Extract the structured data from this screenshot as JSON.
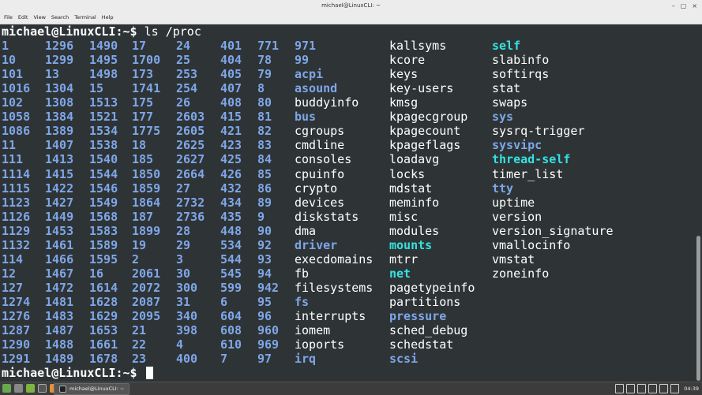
{
  "window": {
    "title": "michael@LinuxCLI: ~",
    "controls": [
      "–",
      "▢",
      "×"
    ]
  },
  "menu": [
    "File",
    "Edit",
    "View",
    "Search",
    "Terminal",
    "Help"
  ],
  "terminal": {
    "prompt": "michael@LinuxCLI",
    "prompt_suffix": ":~$ ",
    "command": "ls /proc",
    "columns": [
      [
        {
          "t": "1",
          "k": "num"
        },
        {
          "t": "10",
          "k": "num"
        },
        {
          "t": "101",
          "k": "num"
        },
        {
          "t": "1016",
          "k": "num"
        },
        {
          "t": "102",
          "k": "num"
        },
        {
          "t": "1058",
          "k": "num"
        },
        {
          "t": "1086",
          "k": "num"
        },
        {
          "t": "11",
          "k": "num"
        },
        {
          "t": "111",
          "k": "num"
        },
        {
          "t": "1114",
          "k": "num"
        },
        {
          "t": "1115",
          "k": "num"
        },
        {
          "t": "1123",
          "k": "num"
        },
        {
          "t": "1126",
          "k": "num"
        },
        {
          "t": "1129",
          "k": "num"
        },
        {
          "t": "1132",
          "k": "num"
        },
        {
          "t": "114",
          "k": "num"
        },
        {
          "t": "12",
          "k": "num"
        },
        {
          "t": "127",
          "k": "num"
        },
        {
          "t": "1274",
          "k": "num"
        },
        {
          "t": "1276",
          "k": "num"
        },
        {
          "t": "1287",
          "k": "num"
        },
        {
          "t": "1290",
          "k": "num"
        },
        {
          "t": "1291",
          "k": "num"
        }
      ],
      [
        {
          "t": "1296",
          "k": "num"
        },
        {
          "t": "1299",
          "k": "num"
        },
        {
          "t": "13",
          "k": "num"
        },
        {
          "t": "1304",
          "k": "num"
        },
        {
          "t": "1308",
          "k": "num"
        },
        {
          "t": "1384",
          "k": "num"
        },
        {
          "t": "1389",
          "k": "num"
        },
        {
          "t": "1407",
          "k": "num"
        },
        {
          "t": "1413",
          "k": "num"
        },
        {
          "t": "1415",
          "k": "num"
        },
        {
          "t": "1422",
          "k": "num"
        },
        {
          "t": "1427",
          "k": "num"
        },
        {
          "t": "1449",
          "k": "num"
        },
        {
          "t": "1453",
          "k": "num"
        },
        {
          "t": "1461",
          "k": "num"
        },
        {
          "t": "1466",
          "k": "num"
        },
        {
          "t": "1467",
          "k": "num"
        },
        {
          "t": "1472",
          "k": "num"
        },
        {
          "t": "1481",
          "k": "num"
        },
        {
          "t": "1483",
          "k": "num"
        },
        {
          "t": "1487",
          "k": "num"
        },
        {
          "t": "1488",
          "k": "num"
        },
        {
          "t": "1489",
          "k": "num"
        }
      ],
      [
        {
          "t": "1490",
          "k": "num"
        },
        {
          "t": "1495",
          "k": "num"
        },
        {
          "t": "1498",
          "k": "num"
        },
        {
          "t": "15",
          "k": "num"
        },
        {
          "t": "1513",
          "k": "num"
        },
        {
          "t": "1521",
          "k": "num"
        },
        {
          "t": "1534",
          "k": "num"
        },
        {
          "t": "1538",
          "k": "num"
        },
        {
          "t": "1540",
          "k": "num"
        },
        {
          "t": "1544",
          "k": "num"
        },
        {
          "t": "1546",
          "k": "num"
        },
        {
          "t": "1549",
          "k": "num"
        },
        {
          "t": "1568",
          "k": "num"
        },
        {
          "t": "1583",
          "k": "num"
        },
        {
          "t": "1589",
          "k": "num"
        },
        {
          "t": "1595",
          "k": "num"
        },
        {
          "t": "16",
          "k": "num"
        },
        {
          "t": "1614",
          "k": "num"
        },
        {
          "t": "1628",
          "k": "num"
        },
        {
          "t": "1629",
          "k": "num"
        },
        {
          "t": "1653",
          "k": "num"
        },
        {
          "t": "1661",
          "k": "num"
        },
        {
          "t": "1678",
          "k": "num"
        }
      ],
      [
        {
          "t": "17",
          "k": "num"
        },
        {
          "t": "1700",
          "k": "num"
        },
        {
          "t": "173",
          "k": "num"
        },
        {
          "t": "1741",
          "k": "num"
        },
        {
          "t": "175",
          "k": "num"
        },
        {
          "t": "177",
          "k": "num"
        },
        {
          "t": "1775",
          "k": "num"
        },
        {
          "t": "18",
          "k": "num"
        },
        {
          "t": "185",
          "k": "num"
        },
        {
          "t": "1850",
          "k": "num"
        },
        {
          "t": "1859",
          "k": "num"
        },
        {
          "t": "1864",
          "k": "num"
        },
        {
          "t": "187",
          "k": "num"
        },
        {
          "t": "1899",
          "k": "num"
        },
        {
          "t": "19",
          "k": "num"
        },
        {
          "t": "2",
          "k": "num"
        },
        {
          "t": "2061",
          "k": "num"
        },
        {
          "t": "2072",
          "k": "num"
        },
        {
          "t": "2087",
          "k": "num"
        },
        {
          "t": "2095",
          "k": "num"
        },
        {
          "t": "21",
          "k": "num"
        },
        {
          "t": "22",
          "k": "num"
        },
        {
          "t": "23",
          "k": "num"
        }
      ],
      [
        {
          "t": "24",
          "k": "num"
        },
        {
          "t": "25",
          "k": "num"
        },
        {
          "t": "253",
          "k": "num"
        },
        {
          "t": "254",
          "k": "num"
        },
        {
          "t": "26",
          "k": "num"
        },
        {
          "t": "2603",
          "k": "num"
        },
        {
          "t": "2605",
          "k": "num"
        },
        {
          "t": "2625",
          "k": "num"
        },
        {
          "t": "2627",
          "k": "num"
        },
        {
          "t": "2664",
          "k": "num"
        },
        {
          "t": "27",
          "k": "num"
        },
        {
          "t": "2732",
          "k": "num"
        },
        {
          "t": "2736",
          "k": "num"
        },
        {
          "t": "28",
          "k": "num"
        },
        {
          "t": "29",
          "k": "num"
        },
        {
          "t": "3",
          "k": "num"
        },
        {
          "t": "30",
          "k": "num"
        },
        {
          "t": "300",
          "k": "num"
        },
        {
          "t": "31",
          "k": "num"
        },
        {
          "t": "340",
          "k": "num"
        },
        {
          "t": "398",
          "k": "num"
        },
        {
          "t": "4",
          "k": "num"
        },
        {
          "t": "400",
          "k": "num"
        }
      ],
      [
        {
          "t": "401",
          "k": "num"
        },
        {
          "t": "404",
          "k": "num"
        },
        {
          "t": "405",
          "k": "num"
        },
        {
          "t": "407",
          "k": "num"
        },
        {
          "t": "408",
          "k": "num"
        },
        {
          "t": "415",
          "k": "num"
        },
        {
          "t": "421",
          "k": "num"
        },
        {
          "t": "423",
          "k": "num"
        },
        {
          "t": "425",
          "k": "num"
        },
        {
          "t": "426",
          "k": "num"
        },
        {
          "t": "432",
          "k": "num"
        },
        {
          "t": "434",
          "k": "num"
        },
        {
          "t": "435",
          "k": "num"
        },
        {
          "t": "448",
          "k": "num"
        },
        {
          "t": "534",
          "k": "num"
        },
        {
          "t": "544",
          "k": "num"
        },
        {
          "t": "545",
          "k": "num"
        },
        {
          "t": "599",
          "k": "num"
        },
        {
          "t": "6",
          "k": "num"
        },
        {
          "t": "604",
          "k": "num"
        },
        {
          "t": "608",
          "k": "num"
        },
        {
          "t": "610",
          "k": "num"
        },
        {
          "t": "7",
          "k": "num"
        }
      ],
      [
        {
          "t": "771",
          "k": "num"
        },
        {
          "t": "78",
          "k": "num"
        },
        {
          "t": "79",
          "k": "num"
        },
        {
          "t": "8",
          "k": "num"
        },
        {
          "t": "80",
          "k": "num"
        },
        {
          "t": "81",
          "k": "num"
        },
        {
          "t": "82",
          "k": "num"
        },
        {
          "t": "83",
          "k": "num"
        },
        {
          "t": "84",
          "k": "num"
        },
        {
          "t": "85",
          "k": "num"
        },
        {
          "t": "86",
          "k": "num"
        },
        {
          "t": "89",
          "k": "num"
        },
        {
          "t": "9",
          "k": "num"
        },
        {
          "t": "90",
          "k": "num"
        },
        {
          "t": "92",
          "k": "num"
        },
        {
          "t": "93",
          "k": "num"
        },
        {
          "t": "94",
          "k": "num"
        },
        {
          "t": "942",
          "k": "num"
        },
        {
          "t": "95",
          "k": "num"
        },
        {
          "t": "96",
          "k": "num"
        },
        {
          "t": "960",
          "k": "num"
        },
        {
          "t": "969",
          "k": "num"
        },
        {
          "t": "97",
          "k": "num"
        }
      ],
      [
        {
          "t": "971",
          "k": "dir"
        },
        {
          "t": "99",
          "k": "dir"
        },
        {
          "t": "acpi",
          "k": "dir"
        },
        {
          "t": "asound",
          "k": "dir"
        },
        {
          "t": "buddyinfo",
          "k": "file"
        },
        {
          "t": "bus",
          "k": "dir"
        },
        {
          "t": "cgroups",
          "k": "file"
        },
        {
          "t": "cmdline",
          "k": "file"
        },
        {
          "t": "consoles",
          "k": "file"
        },
        {
          "t": "cpuinfo",
          "k": "file"
        },
        {
          "t": "crypto",
          "k": "file"
        },
        {
          "t": "devices",
          "k": "file"
        },
        {
          "t": "diskstats",
          "k": "file"
        },
        {
          "t": "dma",
          "k": "file"
        },
        {
          "t": "driver",
          "k": "dir"
        },
        {
          "t": "execdomains",
          "k": "file"
        },
        {
          "t": "fb",
          "k": "file"
        },
        {
          "t": "filesystems",
          "k": "file"
        },
        {
          "t": "fs",
          "k": "dir"
        },
        {
          "t": "interrupts",
          "k": "file"
        },
        {
          "t": "iomem",
          "k": "file"
        },
        {
          "t": "ioports",
          "k": "file"
        },
        {
          "t": "irq",
          "k": "dir"
        }
      ],
      [
        {
          "t": "kallsyms",
          "k": "file"
        },
        {
          "t": "kcore",
          "k": "file"
        },
        {
          "t": "keys",
          "k": "file"
        },
        {
          "t": "key-users",
          "k": "file"
        },
        {
          "t": "kmsg",
          "k": "file"
        },
        {
          "t": "kpagecgroup",
          "k": "file"
        },
        {
          "t": "kpagecount",
          "k": "file"
        },
        {
          "t": "kpageflags",
          "k": "file"
        },
        {
          "t": "loadavg",
          "k": "file"
        },
        {
          "t": "locks",
          "k": "file"
        },
        {
          "t": "mdstat",
          "k": "file"
        },
        {
          "t": "meminfo",
          "k": "file"
        },
        {
          "t": "misc",
          "k": "file"
        },
        {
          "t": "modules",
          "k": "file"
        },
        {
          "t": "mounts",
          "k": "link"
        },
        {
          "t": "mtrr",
          "k": "file"
        },
        {
          "t": "net",
          "k": "link"
        },
        {
          "t": "pagetypeinfo",
          "k": "file"
        },
        {
          "t": "partitions",
          "k": "file"
        },
        {
          "t": "pressure",
          "k": "dir"
        },
        {
          "t": "sched_debug",
          "k": "file"
        },
        {
          "t": "schedstat",
          "k": "file"
        },
        {
          "t": "scsi",
          "k": "dir"
        }
      ],
      [
        {
          "t": "self",
          "k": "link"
        },
        {
          "t": "slabinfo",
          "k": "file"
        },
        {
          "t": "softirqs",
          "k": "file"
        },
        {
          "t": "stat",
          "k": "file"
        },
        {
          "t": "swaps",
          "k": "file"
        },
        {
          "t": "sys",
          "k": "dir"
        },
        {
          "t": "sysrq-trigger",
          "k": "file"
        },
        {
          "t": "sysvipc",
          "k": "dir"
        },
        {
          "t": "thread-self",
          "k": "link"
        },
        {
          "t": "timer_list",
          "k": "file"
        },
        {
          "t": "tty",
          "k": "dir"
        },
        {
          "t": "uptime",
          "k": "file"
        },
        {
          "t": "version",
          "k": "file"
        },
        {
          "t": "version_signature",
          "k": "file"
        },
        {
          "t": "vmallocinfo",
          "k": "file"
        },
        {
          "t": "vmstat",
          "k": "file"
        },
        {
          "t": "zoneinfo",
          "k": "file"
        }
      ]
    ]
  },
  "taskbar": {
    "task_label": "michael@LinuxCLI: ~",
    "clock": "04:39"
  },
  "colors": {
    "terminal_bg": "#2e3436",
    "directory": "#7fa6e8",
    "symlink": "#34e2e2",
    "text": "#ffffff"
  }
}
